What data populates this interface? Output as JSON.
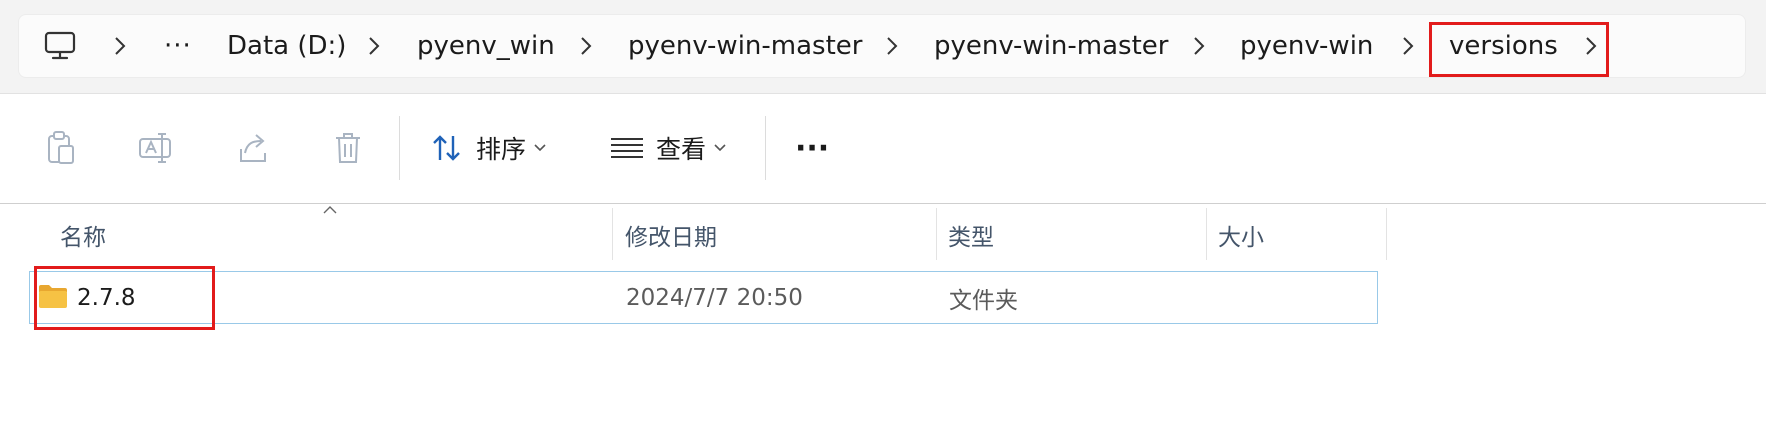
{
  "breadcrumb": {
    "overflow_label": "···",
    "items": [
      {
        "label": "Data (D:)"
      },
      {
        "label": "pyenv_win"
      },
      {
        "label": "pyenv-win-master"
      },
      {
        "label": "pyenv-win-master"
      },
      {
        "label": "pyenv-win"
      },
      {
        "label": "versions"
      }
    ]
  },
  "toolbar": {
    "sort_label": "排序",
    "view_label": "查看",
    "more_label": "···"
  },
  "columns": {
    "name": "名称",
    "modified": "修改日期",
    "type": "类型",
    "size": "大小"
  },
  "files": [
    {
      "name": "2.7.8",
      "modified": "2024/7/7 20:50",
      "type": "文件夹",
      "size": ""
    }
  ],
  "colors": {
    "highlight": "#e21b1b",
    "selection_border": "#99c9e8",
    "folder": "#f6c244",
    "accent": "#1f62b8"
  }
}
